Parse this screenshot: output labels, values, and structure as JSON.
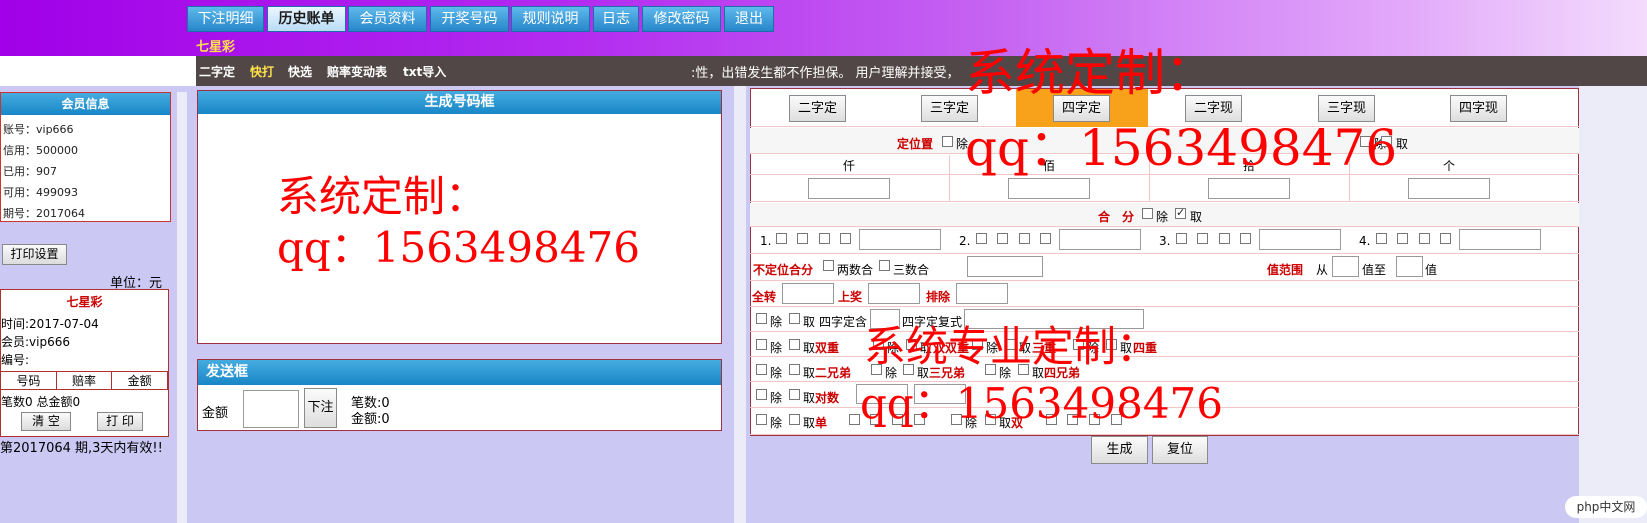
{
  "nav": {
    "tabs": [
      {
        "label": "下注明细",
        "active": false
      },
      {
        "label": "历史账单",
        "active": true
      },
      {
        "label": "会员资料",
        "active": false
      },
      {
        "label": "开奖号码",
        "active": false
      },
      {
        "label": "规则说明",
        "active": false
      },
      {
        "label": "日志",
        "active": false
      },
      {
        "label": "修改密码",
        "active": false
      },
      {
        "label": "退出",
        "active": false
      }
    ],
    "lottery_name": "七星彩"
  },
  "subbar": {
    "items": [
      "二字定",
      "快打",
      "快选",
      "赔率变动表",
      "txt导入"
    ],
    "active_item": "快打",
    "marquee": ":性，出错发生都不作担保。 用户理解并接受，"
  },
  "member": {
    "title": "会员信息",
    "lines": [
      "账号：vip666",
      "信用：500000",
      "已用：907",
      "可用：499093",
      "期号：2017064"
    ]
  },
  "print": {
    "settings_label": "打印设置",
    "unit_label": "单位：元"
  },
  "ticket": {
    "title": "七星彩",
    "time": "时间:2017-07-04",
    "member": "会员:vip666",
    "serial": "编号:",
    "columns": [
      "号码",
      "赔率",
      "金额"
    ],
    "summary": "笔数0 总金额0",
    "clear_label": "清 空",
    "print_label": "打 印",
    "valid_note": "第2017064 期,3天内有效!!"
  },
  "generate_box": {
    "title": "生成号码框"
  },
  "send_box": {
    "title": "发送框",
    "amount_label": "金额",
    "submit_label": "下注",
    "count_text": "笔数:0",
    "total_text": "金额:0"
  },
  "right": {
    "mode_buttons": [
      "二字定",
      "三字定",
      "四字定",
      "二字现",
      "三字现",
      "四字现"
    ],
    "active_mode": "四字定",
    "position_label": "定位置",
    "except": "除",
    "take": "取",
    "take_partial": "取",
    "pos_columns": [
      "仟",
      "佰",
      "拾",
      "个"
    ],
    "combine_label": "合　分",
    "combo_groups": [
      "1.",
      "2.",
      "3.",
      "4."
    ],
    "unfixed_label": "不定位合分",
    "two_sum": "两数合",
    "three_sum": "三数合",
    "range_label": "值范围",
    "from": "从",
    "value_to": "值至",
    "value": "值",
    "full_label": "全转",
    "upper_label": "上奖",
    "exclude_label": "排除",
    "four_contains": "四字定含",
    "four_compound": "四字定复式",
    "double": "双重",
    "double_double": "双双重",
    "triple": "三重",
    "quad": "四重",
    "two_bro": "二兄弟",
    "three_bro": "三兄弟",
    "four_bro": "四兄弟",
    "pair": "对数",
    "odd": "单",
    "even": "双",
    "generate_label": "生成",
    "reset_label": "复位"
  },
  "watermarks": {
    "a": "系统定制：",
    "b": "qq：1563498476",
    "c": "系统定制：",
    "d": "qq：1563498476",
    "e": "系统专业定制：",
    "f": "qq：1563498476"
  },
  "footer_logo": "php中文网"
}
